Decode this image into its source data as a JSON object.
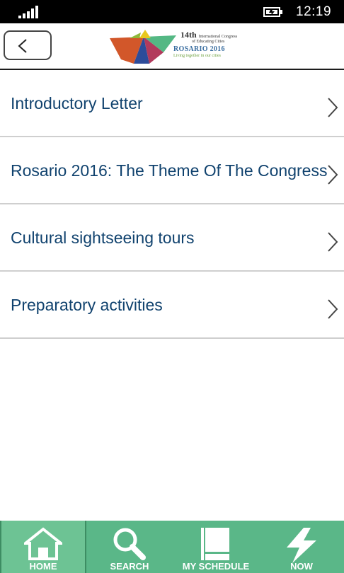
{
  "status_bar": {
    "time": "12:19"
  },
  "header": {
    "logo": {
      "edition": "14th",
      "congress_line1": "International Congress",
      "congress_line2": "of Educating Cities",
      "event": "ROSARIO 2016",
      "motto": "Living together in our cities"
    }
  },
  "menu": {
    "items": [
      {
        "label": "Introductory Letter"
      },
      {
        "label": "Rosario 2016: The Theme Of The Congress"
      },
      {
        "label": "Cultural sightseeing tours"
      },
      {
        "label": "Preparatory activities"
      }
    ]
  },
  "tabs": [
    {
      "label": "HOME",
      "icon": "home-icon",
      "active": true
    },
    {
      "label": "SEARCH",
      "icon": "search-icon",
      "active": false
    },
    {
      "label": "MY SCHEDULE",
      "icon": "book-icon",
      "active": false
    },
    {
      "label": "NOW",
      "icon": "lightning-icon",
      "active": false
    }
  ],
  "colors": {
    "tab_bar": "#5ab788",
    "tab_active": "#6dc394",
    "menu_text": "#10426e",
    "status_bar": "#000000"
  }
}
